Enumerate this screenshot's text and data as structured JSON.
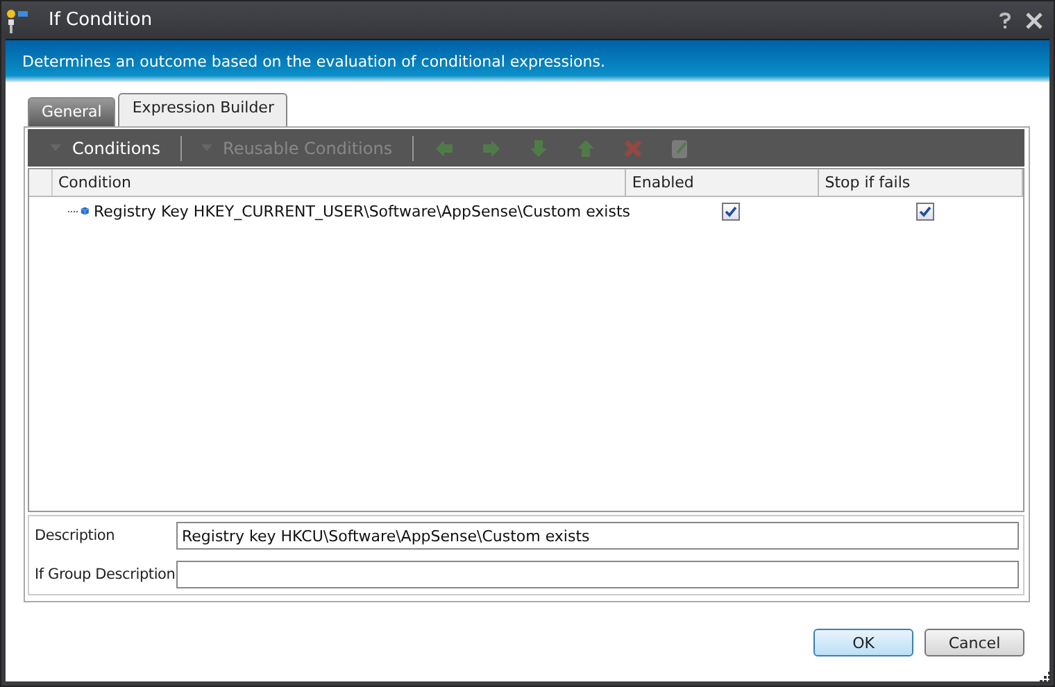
{
  "window": {
    "title": "If Condition"
  },
  "header": {
    "description": "Determines an outcome based on the evaluation of conditional expressions."
  },
  "tabs": [
    {
      "label": "General",
      "selected": false
    },
    {
      "label": "Expression Builder",
      "selected": true
    }
  ],
  "toolbar": {
    "items": [
      {
        "kind": "text",
        "label": "Conditions",
        "disabled": false
      },
      {
        "kind": "text",
        "label": "Reusable Conditions",
        "disabled": true
      },
      {
        "kind": "left-arrow",
        "disabled": true
      },
      {
        "kind": "right-arrow",
        "disabled": true
      },
      {
        "kind": "down-arrow",
        "disabled": true
      },
      {
        "kind": "up-arrow",
        "disabled": true
      },
      {
        "kind": "delete",
        "disabled": true
      },
      {
        "kind": "edit",
        "disabled": true
      }
    ]
  },
  "table": {
    "columns": [
      "Condition",
      "Enabled",
      "Stop if fails"
    ],
    "rows": [
      {
        "condition": "Registry Key HKEY_CURRENT_USER\\Software\\AppSense\\Custom exists",
        "enabled": true,
        "stop_if_fails": true
      }
    ]
  },
  "fields": [
    {
      "label": "Description",
      "value": "Registry key HKCU\\Software\\AppSense\\Custom exists"
    },
    {
      "label": "If Group Description"
    }
  ],
  "buttons": [
    {
      "label": "OK",
      "default": true
    },
    {
      "label": "Cancel",
      "default": false
    }
  ]
}
